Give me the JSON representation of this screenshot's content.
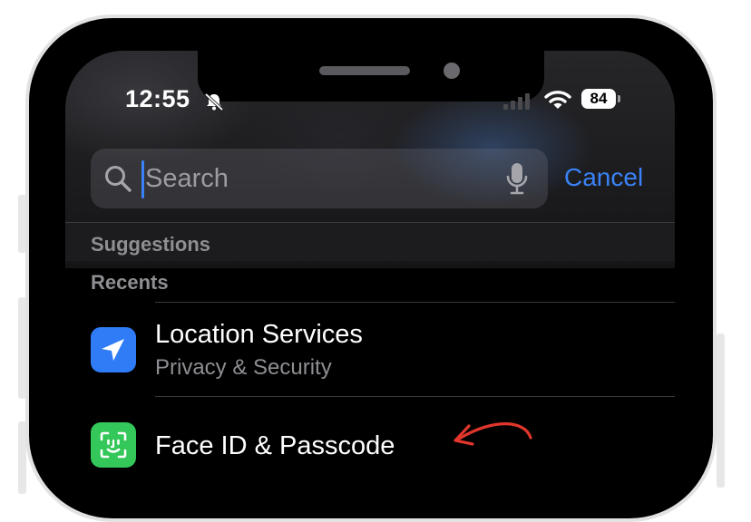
{
  "status_bar": {
    "time": "12:55",
    "battery_level": "84",
    "wifi_icon": "wifi-icon",
    "silent_icon": "bell-slash-icon",
    "signal_icon": "cellular-signal-icon"
  },
  "search": {
    "placeholder": "Search",
    "value": "",
    "search_icon": "magnifying-glass-icon",
    "mic_icon": "microphone-icon"
  },
  "cancel_label": "Cancel",
  "sections": {
    "suggestions": "Suggestions",
    "recents": "Recents"
  },
  "recents": [
    {
      "title": "Location Services",
      "subtitle": "Privacy & Security",
      "icon": "location-arrow-icon",
      "icon_color": "#2f7cf6"
    },
    {
      "title": "Face ID & Passcode",
      "icon": "face-id-icon",
      "icon_color": "#34c759"
    }
  ],
  "annotation": {
    "icon": "red-arrow-annotation",
    "color": "#e0362c"
  },
  "colors": {
    "accent": "#3a82f7",
    "background": "#000000",
    "secondary_text": "#8e8e93"
  }
}
